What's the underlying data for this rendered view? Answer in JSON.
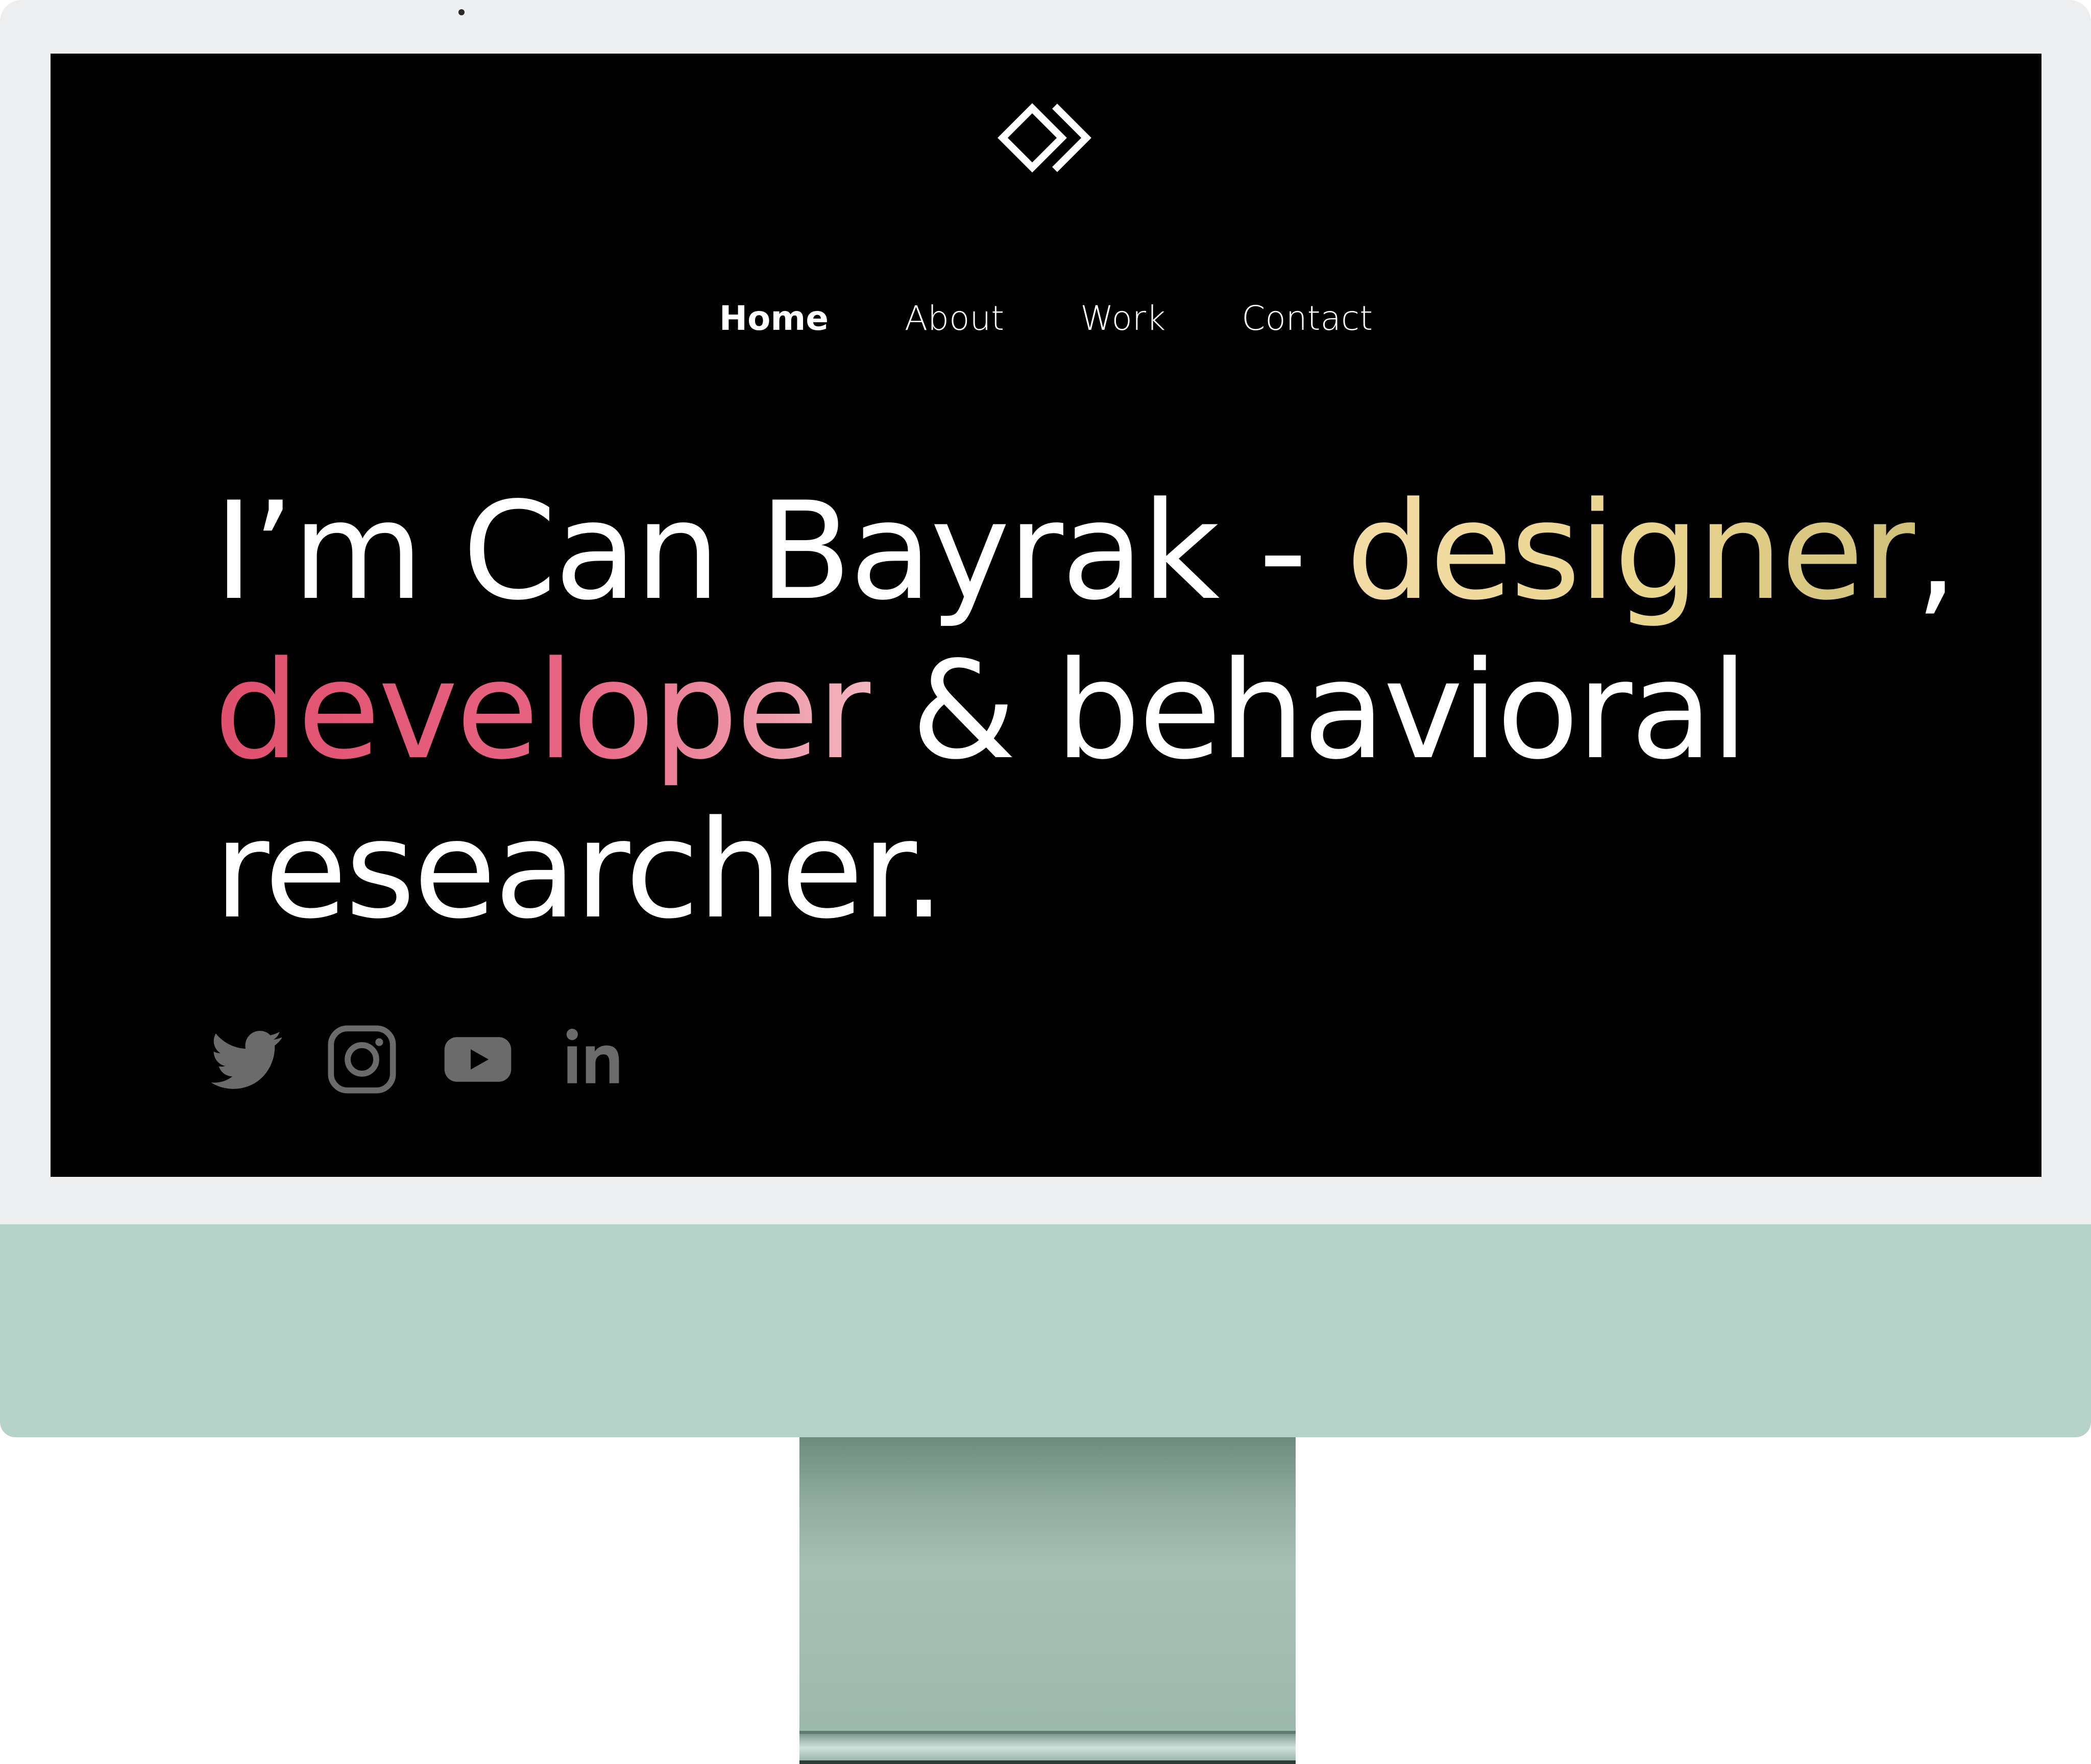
{
  "site": {
    "nav": {
      "items": [
        {
          "label": "Home",
          "active": true
        },
        {
          "label": "About",
          "active": false
        },
        {
          "label": "Work",
          "active": false
        },
        {
          "label": "Contact",
          "active": false
        }
      ]
    },
    "hero": {
      "part1": "I’m Can Bayrak - ",
      "highlight1": "designer",
      "part2": ",",
      "highlight2": "developer",
      "part3": " & behavioral",
      "part4": "researcher."
    },
    "social": [
      {
        "icon": "twitter-icon"
      },
      {
        "icon": "instagram-icon"
      },
      {
        "icon": "youtube-icon"
      },
      {
        "icon": "linkedin-icon"
      }
    ]
  },
  "colors": {
    "screen_bg": "#000000",
    "text": "#ffffff",
    "gradient_yellow": [
      "#f3dca6",
      "#cfc07a"
    ],
    "gradient_pink": [
      "#e0506e",
      "#f3b7bf"
    ],
    "social_icon": "#6b6b6b",
    "bezel": "#edeef0",
    "chin": "#b6d2c9",
    "stand": "#9cb7ac"
  }
}
